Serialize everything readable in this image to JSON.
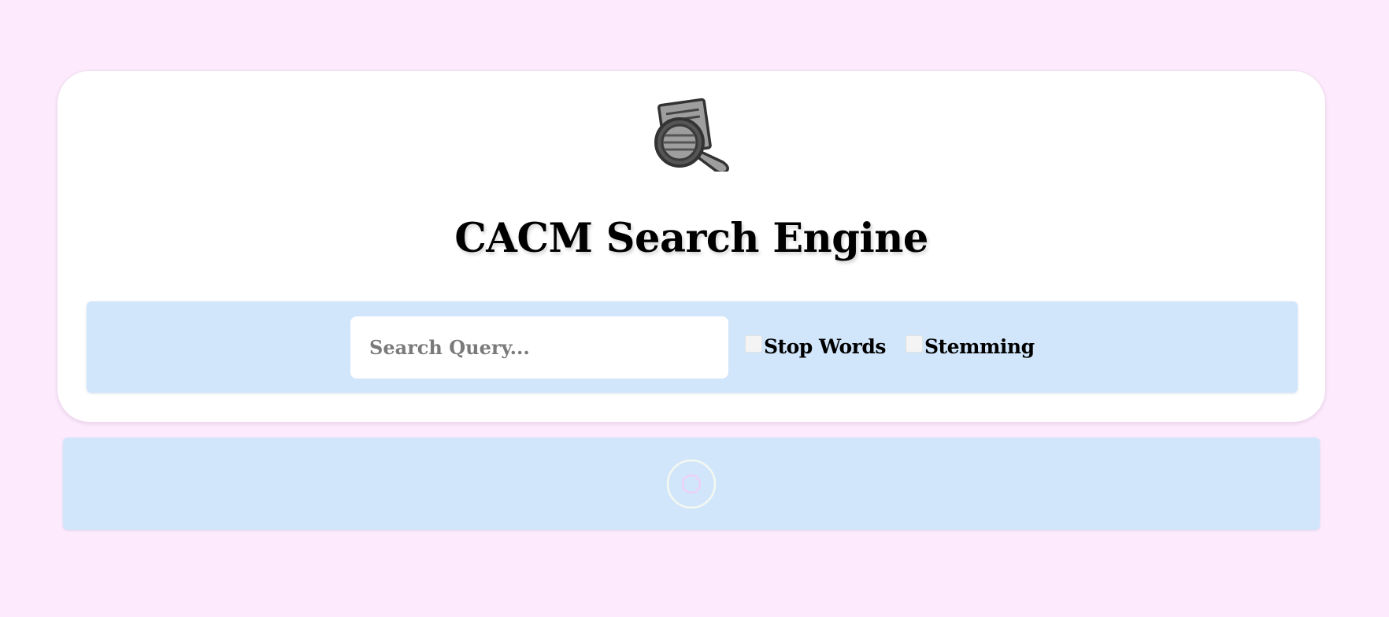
{
  "header": {
    "logo_icon": "magnifier-document-icon",
    "title": "CACM Search Engine"
  },
  "search": {
    "placeholder": "Search Query...",
    "value": "",
    "options": [
      {
        "label": "Stop Words",
        "checked": false
      },
      {
        "label": "Stemming",
        "checked": false
      }
    ]
  },
  "results": {
    "status_icon": "loading-spinner-icon"
  },
  "colors": {
    "page_background": "#fdebfd",
    "panel_background": "#d1e5fb",
    "card_background": "#ffffff"
  }
}
